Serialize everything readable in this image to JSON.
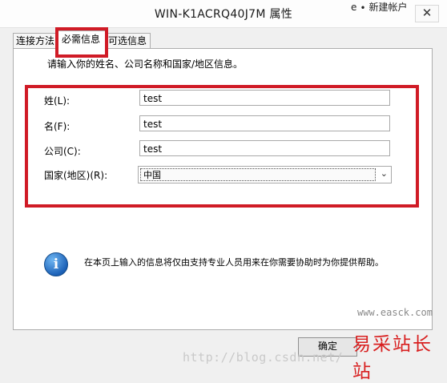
{
  "window": {
    "title": "WIN-K1ACRQ40J7M 属性",
    "close_glyph": "✕",
    "bg_fragment": "e ∙ 新建帐户"
  },
  "tabs": [
    {
      "label": "连接方法"
    },
    {
      "label": "必需信息",
      "selected": true
    },
    {
      "label": "可选信息"
    }
  ],
  "main": {
    "intro": "请输入你的姓名、公司名称和国家/地区信息。",
    "fields": [
      {
        "label": "姓(L):",
        "value": "test"
      },
      {
        "label": "名(F):",
        "value": "test"
      },
      {
        "label": "公司(C):",
        "value": "test"
      }
    ],
    "country": {
      "label": "国家(地区)(R):",
      "selected": "中国"
    },
    "info_note": "在本页上输入的信息将仅由支持专业人员用来在你需要协助时为你提供帮助。"
  },
  "footer": {
    "ok_label": "确定"
  },
  "watermarks": {
    "blog": "http://blog.csdn.net/",
    "url": "www.easck.com",
    "site": "易采站长站"
  },
  "colors": {
    "highlight": "#d01b26",
    "watermark_red": "#d81f1f"
  }
}
